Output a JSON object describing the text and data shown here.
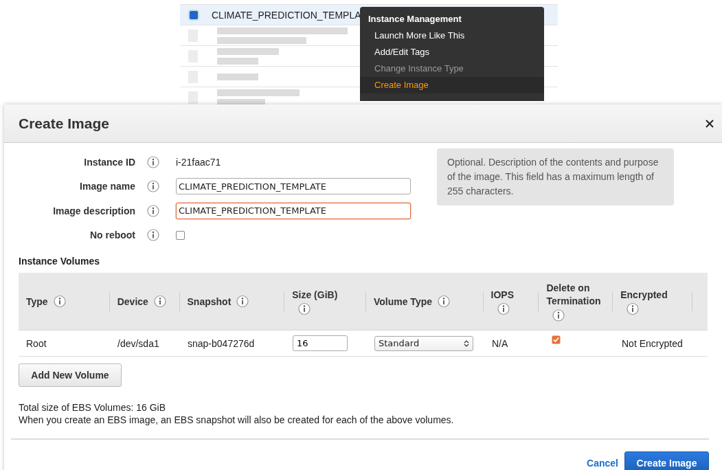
{
  "instances": {
    "rows": [
      {
        "name": "CLIMATE_PREDICTION_TEMPLA",
        "checked": true,
        "selected": true
      },
      {
        "checked": false,
        "selected": false
      },
      {
        "checked": false,
        "selected": false
      },
      {
        "checked": false,
        "selected": false
      },
      {
        "checked": false,
        "selected": false
      }
    ]
  },
  "context_menu": {
    "heading": "Instance Management",
    "items": [
      {
        "label": "Launch More Like This",
        "disabled": false,
        "selected": false
      },
      {
        "label": "Add/Edit Tags",
        "disabled": false,
        "selected": false
      },
      {
        "label": "Change Instance Type",
        "disabled": true,
        "selected": false
      },
      {
        "label": "Create Image",
        "disabled": false,
        "selected": true
      }
    ]
  },
  "dialog": {
    "title": "Create Image",
    "tooltip": "Optional. Description of the contents and purpose of the image. This field has a maximum length of 255 characters.",
    "fields": [
      {
        "kind": "text",
        "label": "Instance ID",
        "value": "i-21faac71"
      },
      {
        "kind": "input",
        "label": "Image name",
        "value": "CLIMATE_PREDICTION_TEMPLATE",
        "focused": false
      },
      {
        "kind": "input",
        "label": "Image description",
        "value": "CLIMATE_PREDICTION_TEMPLATE",
        "focused": true
      },
      {
        "kind": "checkbox",
        "label": "No reboot",
        "checked": false
      }
    ],
    "volumes_heading": "Instance Volumes",
    "columns": [
      "Type",
      "Device",
      "Snapshot",
      "Size (GiB)",
      "Volume Type",
      "IOPS",
      "Delete on Termination",
      "Encrypted"
    ],
    "volumes": [
      {
        "type": "Root",
        "device": "/dev/sda1",
        "snapshot": "snap-b047276d",
        "size": "16",
        "volume_type": "Standard",
        "iops": "N/A",
        "delete_on_termination": true,
        "encrypted": "Not Encrypted"
      }
    ],
    "add_button": "Add New Volume",
    "total": "Total size of EBS Volumes: 16 GiB",
    "note": "When you create an EBS image, an EBS snapshot will also be created for each of the above volumes.",
    "cancel": "Cancel",
    "submit": "Create Image"
  }
}
